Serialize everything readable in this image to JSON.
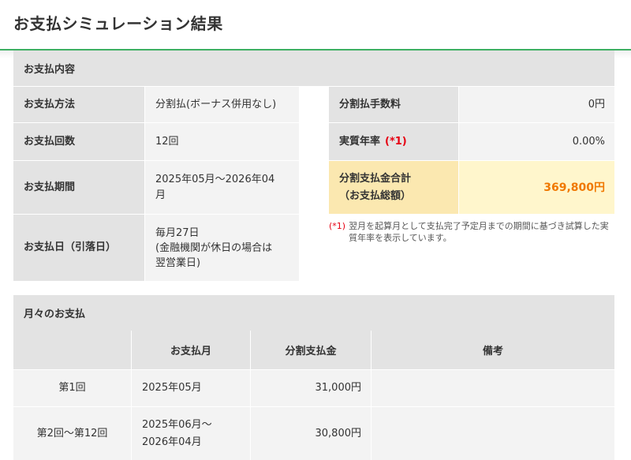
{
  "page": {
    "title": "お支払シミュレーション結果"
  },
  "payment_details": {
    "heading": "お支払内容",
    "rows": [
      {
        "label": "お支払方法",
        "value": "分割払(ボーナス併用なし)"
      },
      {
        "label": "お支払回数",
        "value": "12回"
      },
      {
        "label": "お支払期間",
        "value": "2025年05月～2026年04\n月"
      },
      {
        "label": "お支払日（引落日）",
        "value": "毎月27日\n(金融機関が休日の場合は\n翌営業日)"
      }
    ],
    "fee_label": "分割払手数料",
    "fee_value": "0円",
    "apr_label": "実質年率",
    "apr_mark": "(*1)",
    "apr_value": "0.00%",
    "total_label": "分割支払金合計\n（お支払総額）",
    "total_value": "369,800円",
    "note_mark": "(*1)",
    "note_text": "翌月を起算月として支払完了予定月までの期間に基づき試算した実質年率を表示しています。"
  },
  "monthly": {
    "heading": "月々のお支払",
    "columns": [
      "",
      "お支払月",
      "分割支払金",
      "備考"
    ],
    "rows": [
      {
        "no": "第1回",
        "month": "2025年05月",
        "amount": "31,000円",
        "remark": ""
      },
      {
        "no": "第2回～第12回",
        "month": "2025年06月～\n2026年04月",
        "amount": "30,800円",
        "remark": ""
      }
    ]
  },
  "colors": {
    "accent_line": "#3daf62",
    "total_amount": "#f07800",
    "required_mark": "#e60012"
  }
}
